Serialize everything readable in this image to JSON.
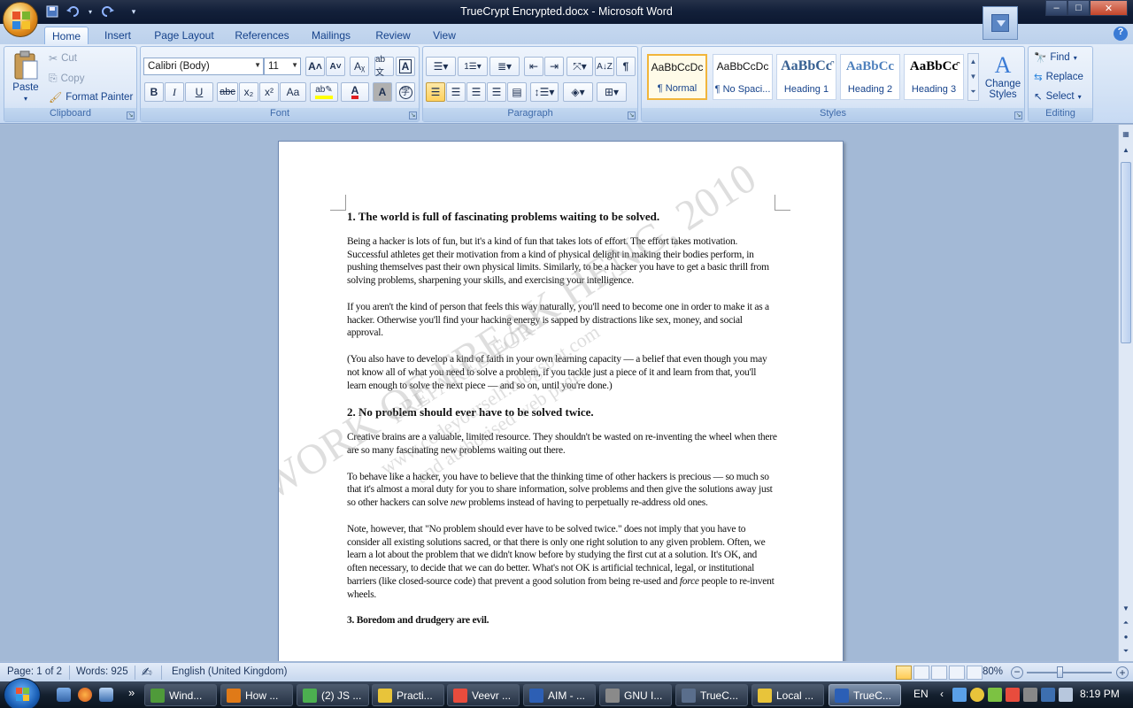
{
  "window": {
    "title": "TrueCrypt Encrypted.docx - Microsoft Word",
    "min": "–",
    "max": "□",
    "close": "✕"
  },
  "tabs": [
    "Home",
    "Insert",
    "Page Layout",
    "References",
    "Mailings",
    "Review",
    "View"
  ],
  "help_label": "?",
  "ribbon": {
    "clipboard": {
      "label": "Clipboard",
      "paste": "Paste",
      "cut": "Cut",
      "copy": "Copy",
      "format_painter": "Format Painter"
    },
    "font": {
      "label": "Font",
      "font_name": "Calibri (Body)",
      "font_size": "11",
      "bold": "B",
      "italic": "I",
      "underline": "U",
      "strike": "abc",
      "sub": "x₂",
      "sup": "x²",
      "case": "Aa",
      "grow": "A˄",
      "shrink": "A˅"
    },
    "paragraph": {
      "label": "Paragraph",
      "pilcrow": "¶"
    },
    "styles": {
      "label": "Styles",
      "items": [
        {
          "sample": "AaBbCcDc",
          "name": "¶ Normal"
        },
        {
          "sample": "AaBbCcDc",
          "name": "¶ No Spaci..."
        },
        {
          "sample": "AaBbCƈ",
          "name": "Heading 1"
        },
        {
          "sample": "AaBbCc",
          "name": "Heading 2"
        },
        {
          "sample": "AaBbCƈ",
          "name": "Heading 3"
        }
      ],
      "change_styles": "Change\nStyles"
    },
    "editing": {
      "label": "Editing",
      "find": "Find",
      "replace": "Replace",
      "select": "Select"
    }
  },
  "document": {
    "h1": "1. The world is full of fascinating problems  waiting to be solved.",
    "p1": "Being a hacker is lots of fun, but it's a kind of fun that takes lots of effort. The effort takes motivation. Successful athletes get their motivation from a kind of physical delight in making their bodies perform, in pushing themselves past their own physical limits. Similarly, to be a hacker you have to get a basic thrill from solving problems, sharpening your skills, and exercising your intelligence.",
    "p2": "If you aren't the kind of person that feels this way naturally, you'll need to become one in order to make it as a hacker. Otherwise you'll find your hacking energy is sapped by distractions like sex, money, and social approval.",
    "p3": "(You also have to develop a kind of faith in your own learning capacity — a belief that even though you may not know all of what you need to solve a problem, if you tackle just a piece of it and learn from that, you'll learn enough to solve the next piece — and so on, until you're done.)",
    "h2": "2. No problem  should ever have to be solved  twice.",
    "p4": "Creative brains are a valuable, limited resource. They shouldn't be wasted on re-inventing the wheel when there are so many fascinating new problems waiting out there.",
    "p5a": "To behave like a hacker, you have to believe that the thinking time of other hackers is precious — so much so that it's almost a moral duty for you to share information, solve problems and then give the solutions away just so other hackers can solve ",
    "p5em": "new",
    "p5b": " problems instead of having to perpetually re-address old ones.",
    "p6a": "Note, however, that \"No problem should ever have to be solved twice.\" does not imply that you have to consider all existing solutions sacred, or that there is only one right solution to any given problem. Often, we learn a lot about the problem that we didn't know before by studying the first cut at a solution. It's OK, and often necessary, to decide that we can do better. What's not OK is artificial technical, legal, or institutional barriers (like closed-source code) that prevent a good solution from being re-used and ",
    "p6em": "force",
    "p6b": " people to re-invent wheels.",
    "p7": "3. Boredom and drudgery are evil."
  },
  "watermark": {
    "line1": "WORK OF FREAK HENG, 2010",
    "line2": "PREPARED FOR",
    "line3": "www.codeyourself.blogspot.com",
    "line4": "and authorised web pages"
  },
  "statusbar": {
    "page": "Page: 1 of 2",
    "words": "Words: 925",
    "language": "English (United Kingdom)",
    "zoom": "80%",
    "zoom_value_percent": 80
  },
  "taskbar": {
    "items": [
      {
        "label": "Wind...",
        "color": "#4f9a3a"
      },
      {
        "label": "How ...",
        "color": "#e07a18"
      },
      {
        "label": "(2) JS ...",
        "color": "#4caf50"
      },
      {
        "label": "Practi...",
        "color": "#e8c43a"
      },
      {
        "label": "Veevr ...",
        "color": "#e84c3d"
      },
      {
        "label": "AIM - ...",
        "color": "#2d5fb4"
      },
      {
        "label": "GNU I...",
        "color": "#8a8a8a"
      },
      {
        "label": "TrueC...",
        "color": "#5a6e8c"
      },
      {
        "label": "Local ...",
        "color": "#e8c43a"
      },
      {
        "label": "TrueC...",
        "color": "#2b5fb6"
      }
    ],
    "lang": "EN",
    "time": "8:19 PM",
    "chevron": "»"
  }
}
